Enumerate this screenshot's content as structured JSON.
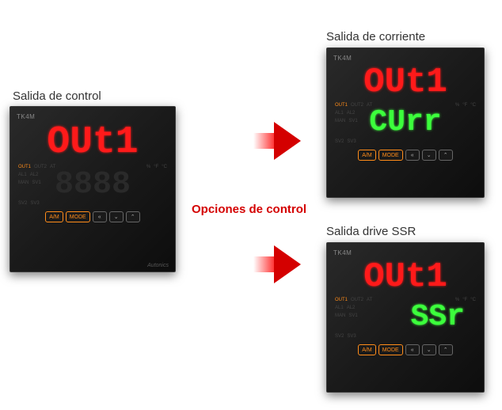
{
  "labels": {
    "left": "Salida de control",
    "center": "Opciones de control",
    "topRight": "Salida de corriente",
    "bottomRight": "Salida drive SSR"
  },
  "device": {
    "model": "TK4M",
    "brand": "Autonics",
    "indicators": {
      "out1": "OUT1",
      "out2": "OUT2",
      "at": "AT",
      "pct": "%",
      "f": "°F",
      "c": "°C",
      "al1": "AL1",
      "al2": "AL2",
      "man": "MAN",
      "sv1": "SV1",
      "sv2": "SV2",
      "sv3": "SV3"
    },
    "buttons": {
      "am": "A/M",
      "mode": "MODE",
      "left": "«",
      "down": "⌄",
      "up": "⌃"
    }
  },
  "readouts": {
    "main_top": "OUt1",
    "main_bottom": "8888",
    "current_top": "OUt1",
    "current_bottom": "CUrr",
    "ssr_top": "OUt1",
    "ssr_bottom": "SSr"
  }
}
